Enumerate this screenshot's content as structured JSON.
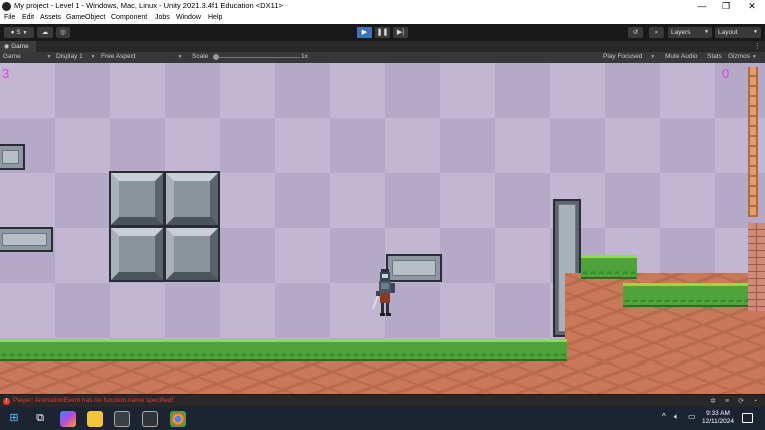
{
  "window": {
    "title": "My project - Level 1 - Windows, Mac, Linux - Unity 2021.3.4f1 Education <DX11>",
    "minimize": "—",
    "restore": "❐",
    "close": "✕"
  },
  "menu": {
    "items": [
      "File",
      "Edit",
      "Assets",
      "GameObject",
      "Component",
      "Jobs",
      "Window",
      "Help"
    ]
  },
  "toolbar": {
    "account_label": "S",
    "layers_label": "Layers",
    "layout_label": "Layout",
    "play_icon": "play-icon",
    "pause_icon": "pause-icon",
    "step_icon": "step-icon"
  },
  "tab": {
    "label": "Game",
    "more": "⋮"
  },
  "gamebar": {
    "view_mode": "Game",
    "display": "Display 1",
    "aspect": "Free Aspect",
    "scale_label": "Scale",
    "scale_value": "1x",
    "play_focused": "Play Focused",
    "mute_audio": "Mute Audio",
    "stats": "Stats",
    "gizmos": "Gizmos"
  },
  "game": {
    "score_left": "3",
    "score_right": "0"
  },
  "console": {
    "error_text": "Player: AnimationEvent has no function name specified!"
  },
  "taskbar": {
    "time": "9:33 AM",
    "date": "12/11/2024"
  },
  "colors": {
    "accent_play": "#3d72b8",
    "score": "#e040e0",
    "error": "#e53935"
  }
}
